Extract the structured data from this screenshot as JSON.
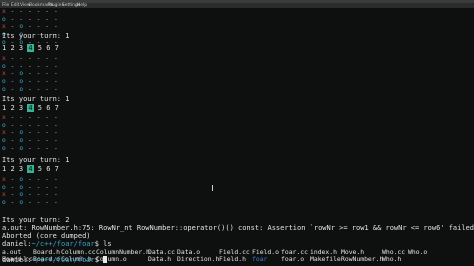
{
  "menu": [
    "File",
    "Edit",
    "View",
    "Bookmarks",
    "Plugins",
    "Settings",
    "Help"
  ],
  "turn_prompt": "Its your turn:",
  "turn_values": [
    "1",
    "1",
    "1",
    "2"
  ],
  "column_numbers": [
    "1",
    "2",
    "3",
    "4",
    "5",
    "6",
    "7"
  ],
  "selected_column": "4",
  "boards": {
    "board1": [
      [
        "x",
        "-",
        "-",
        "-",
        "-",
        "-",
        "-"
      ],
      [
        "o",
        "-",
        "-",
        "-",
        "-",
        "-",
        "-"
      ],
      [
        "x",
        "-",
        "o",
        "-",
        "-",
        "-",
        "-"
      ],
      [
        "o",
        "-",
        "o",
        "-",
        "-",
        "-",
        "-"
      ],
      [
        "o",
        "-",
        "o",
        "-",
        "-",
        "-",
        "-"
      ]
    ],
    "board2": [
      [
        "x",
        "-",
        "-",
        "-",
        "-",
        "-",
        "-"
      ],
      [
        "o",
        "-",
        "-",
        "-",
        "-",
        "-",
        "-"
      ],
      [
        "x",
        "-",
        "o",
        "-",
        "-",
        "-",
        "-"
      ],
      [
        "o",
        "-",
        "o",
        "-",
        "-",
        "-",
        "-"
      ],
      [
        "o",
        "-",
        "o",
        "-",
        "-",
        "-",
        "-"
      ]
    ],
    "board3": [
      [
        "x",
        "-",
        "-",
        "-",
        "-",
        "-",
        "-"
      ],
      [
        "o",
        "-",
        "-",
        "-",
        "-",
        "-",
        "-"
      ],
      [
        "x",
        "-",
        "o",
        "-",
        "-",
        "-",
        "-"
      ],
      [
        "o",
        "-",
        "o",
        "-",
        "-",
        "-",
        "-"
      ],
      [
        "o",
        "-",
        "o",
        "-",
        "-",
        "-",
        "-"
      ]
    ],
    "board4": [
      [
        "x",
        "-",
        "o",
        "-",
        "-",
        "-",
        "-"
      ],
      [
        "o",
        "-",
        "o",
        "-",
        "-",
        "-",
        "-"
      ],
      [
        "x",
        "-",
        "o",
        "-",
        "-",
        "-",
        "-"
      ],
      [
        "o",
        "-",
        "o",
        "-",
        "-",
        "-",
        "-"
      ]
    ]
  },
  "error_line": "a.out: RowNumber.h:75: RowNr_nt RowNumber::operator()() const: Assertion `rowNr >= row1 && rowNr <= row6' failed.",
  "aborted_line": "Aborted (core dumped)",
  "prompt": {
    "user": "daniel",
    "path": "~/c++/foar/foar",
    "command1": "ls",
    "command2": ""
  },
  "files_row1": [
    "a.out",
    "Board.h",
    "Column.cc",
    "ColumnNumber.h",
    "Data.cc",
    "Data.o",
    "Field.cc",
    "Field.o",
    "foar.cc",
    "index.h",
    "Move.h",
    "Who.cc",
    "Who.o"
  ],
  "files_row2": [
    "Board.cc",
    "Board.o",
    "Column.h",
    "Column.o",
    "Data.h",
    "Direction.h",
    "Field.h",
    "foar",
    "foar.o",
    "Makefile",
    "RowNumber.h",
    "Who.h"
  ],
  "colors": {
    "x_mark": "#c84848",
    "o_mark": "#3fb0d8",
    "selection": "#35b394",
    "directory": "#3f7fd0",
    "path": "#3aa3c7"
  }
}
